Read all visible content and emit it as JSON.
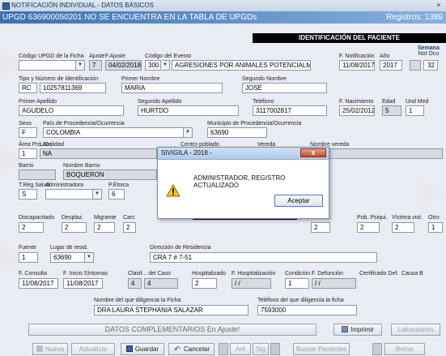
{
  "window": {
    "title": "NOTIFICACIÓN INDIVIDUAL - DATOS BÁSICOS",
    "close": "×"
  },
  "banner": {
    "text": "UPGD 636900050201 NO SE ENCUENTRA EN LA TABLA DE UPGDs",
    "records": "Registros: 1389"
  },
  "section_title": "IDENTIFICACIÓN DEL PACIENTE",
  "labels": {
    "codigo_upgd": "Código UPGD de la Ficha",
    "ajuste": "Ajuste",
    "f_ajuste": "F.Ajuste",
    "codigo_evento": "Código del Evento",
    "f_notificacion": "F. Notificación",
    "anio": "Año",
    "semana": "Semana",
    "semana_sub": "Not Ocu",
    "tipo_num_id": "Tipo y Número de Identificación",
    "primer_nombre": "Primer Nombre",
    "segundo_nombre": "Segundo Nombre",
    "primer_apellido": "Primer Apellido",
    "segundo_apellido": "Segundo Apellido",
    "telefono": "Teléfono",
    "f_nacimiento": "F. Nacimiento",
    "edad": "Edad",
    "und_med": "Und Med",
    "sexo": "Sexo",
    "pais": "País de Procedencia/Ocurrencia",
    "municipio": "Municipio de Procedencia/Ocurrencia",
    "area": "Área Pro./Oc",
    "localidad": "Localidad",
    "centro_poblado": "Centro poblado",
    "vereda": "Vereda",
    "nombre_vereda": "Nombre vereda",
    "barrio": "Barrio",
    "nombre_barrio": "Nombre Barrio",
    "t_reg_salud": "T.Rég Salud",
    "administradora": "Administradora",
    "p_etnica": "P.Étnica",
    "discapacitado": "Discapacitado",
    "desplaz": "Desplaz.",
    "migrante": "Migrante",
    "carc": "Carc",
    "ilizado": "ilizado",
    "pob_psiqui": "Pob. Psiqui.",
    "victima_viol": "Víctima viol.",
    "otro": "Otro",
    "fuente": "Fuente",
    "lugar_resid": "Lugar de resid.",
    "direccion": "Dirección de Residencia",
    "f_consulta": "F. Consulta",
    "f_inicio": "F. Inicio Síntomas",
    "clasif": "Clasif... del Caso",
    "hospitalizado": "Hospitalizado",
    "f_hosp": "F. Hospitalización",
    "condicion": "Condición",
    "f_defuncion": "F. Defunción",
    "cert_def": "Certificado Def.",
    "causa_b": "Causa B",
    "nombre_diligencia": "Nombre del que diligencia la Ficha",
    "tel_diligencia": "Teléfono del que diligencia la ficha"
  },
  "values": {
    "ajuste": "7",
    "f_ajuste": "04/02/2018",
    "codigo_evento": "300",
    "evento_nombre": "AGRESIONES POR ANIMALES POTENCIALM",
    "f_notificacion": "11/08/2017",
    "anio": "2017",
    "semana_ocu": "32",
    "tipo_id": "RC",
    "numero_id": "10257811369",
    "primer_nombre": "MARIA",
    "segundo_nombre": "JOSÉ",
    "primer_apellido": "AGUDELO",
    "segundo_apellido": "HURTDO",
    "telefono": "3117002817",
    "f_nacimiento": "25/02/2012",
    "edad": "5",
    "und_med": "1",
    "sexo": "F",
    "pais": "COLOMBIA",
    "municipio": "63690",
    "area": "1",
    "localidad": "NA",
    "nombre_barrio": "BOQUERON",
    "t_reg_salud": "S",
    "p_etnica": "6",
    "discapacitado": "2",
    "desplaz": "2",
    "migrante": "2",
    "carc": "2",
    "ilizado": "2",
    "pob_psiqui": "2",
    "victima_viol": "2",
    "otro": "1",
    "fuente": "1",
    "lugar_resid": "63690",
    "direccion": "CRA 7 # 7-51",
    "f_consulta": "11/08/2017",
    "f_inicio": "11/08/2017",
    "clasif_a": "4",
    "clasif_b": "4",
    "hospitalizado": "2",
    "f_hosp": "/ /",
    "condicion": "1",
    "f_defuncion": "/ /",
    "nombre_diligencia": "DRA LAURA STEPHANIA SALAZAR",
    "tel_diligencia": "7593000"
  },
  "datos_complementarios": "DATOS COMPLEMENTARIOS En Ajuste!",
  "buttons": {
    "imprimir": "Imprimir",
    "laboratorios": "Laboratorios",
    "nueva": "Nueva",
    "actualizar": "Actualizar",
    "guardar": "Guardar",
    "cancelar": "Cancelar",
    "ant": "Ant",
    "sig": "Sig",
    "buscar": "Buscar Pacientes",
    "borrar": "Borrar"
  },
  "dialog": {
    "title": "SIVIGILA - 2018 -",
    "message": "ADMINISTRADOR, REGISTRO ACTUALIZADO",
    "ok": "Aceptar",
    "close": "x"
  },
  "colors": {
    "banner": "#3f6fae",
    "accent_red": "#c7452f"
  }
}
